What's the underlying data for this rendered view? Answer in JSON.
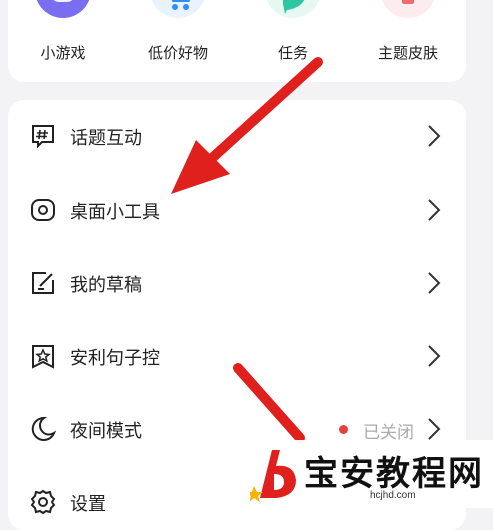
{
  "shortcuts": [
    {
      "label": "小游戏",
      "color": "#7b6df2",
      "icon": "gamepad-icon"
    },
    {
      "label": "低价好物",
      "color": "#2f8ef5",
      "icon": "shopping-cart-icon"
    },
    {
      "label": "任务",
      "color": "#2cc7a0",
      "icon": "task-bubble-icon"
    },
    {
      "label": "主题皮肤",
      "color": "#f06a6a",
      "icon": "theme-skin-icon"
    }
  ],
  "menu": {
    "items": [
      {
        "label": "话题互动",
        "icon": "hashtag-chat-icon"
      },
      {
        "label": "桌面小工具",
        "icon": "widget-icon"
      },
      {
        "label": "我的草稿",
        "icon": "draft-edit-icon"
      },
      {
        "label": "安利句子控",
        "icon": "star-bookmark-icon"
      },
      {
        "label": "夜间模式",
        "icon": "moon-icon",
        "status": "已关闭"
      },
      {
        "label": "设置",
        "icon": "gear-icon"
      }
    ]
  },
  "watermark": {
    "title": "宝安教程网",
    "url": "hcjhd.com"
  },
  "colors": {
    "arrow": "#e0201c",
    "status_dot": "#e8413c",
    "background": "#f3f3f5"
  }
}
